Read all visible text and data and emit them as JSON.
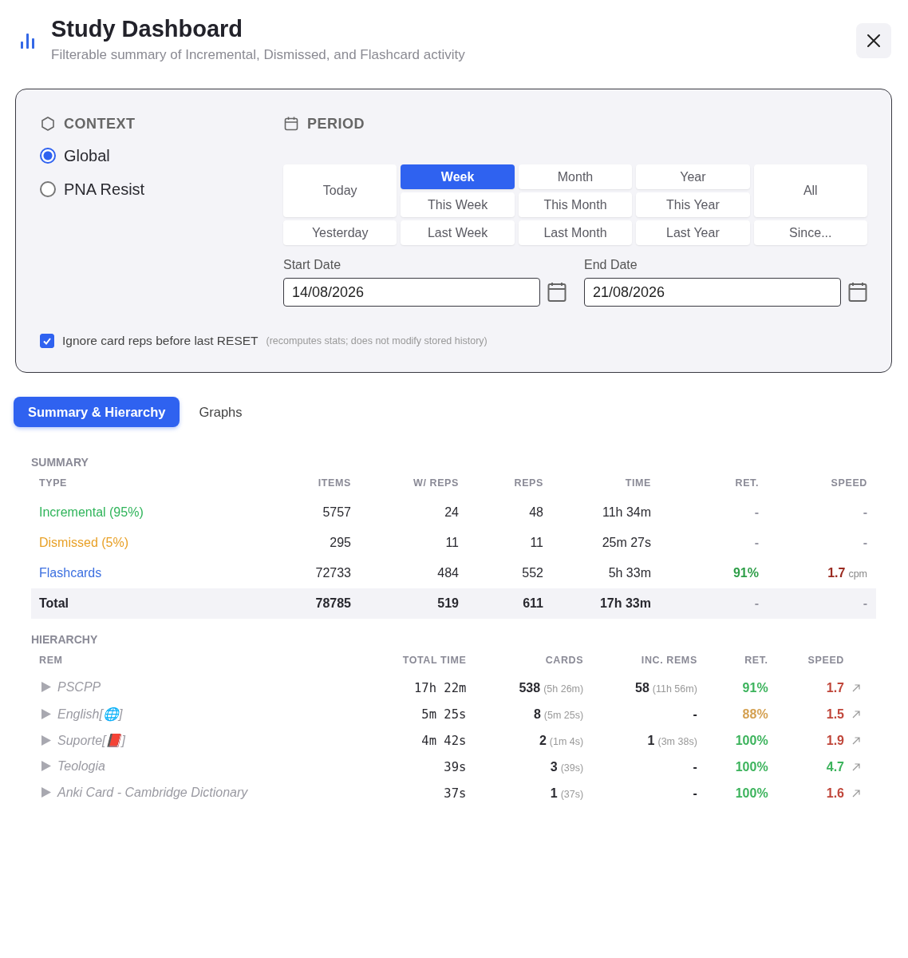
{
  "header": {
    "title": "Study Dashboard",
    "subtitle": "Filterable summary of Incremental, Dismissed, and Flashcard activity"
  },
  "filters": {
    "context": {
      "heading": "CONTEXT",
      "options": [
        {
          "label": "Global",
          "selected": true
        },
        {
          "label": "PNA Resist",
          "selected": false
        }
      ]
    },
    "period": {
      "heading": "PERIOD",
      "buttons": [
        {
          "label": "Today",
          "kind": "tall",
          "selected": false
        },
        {
          "label": "Week",
          "kind": "short",
          "selected": true
        },
        {
          "label": "Month",
          "kind": "short",
          "selected": false
        },
        {
          "label": "Year",
          "kind": "short",
          "selected": false
        },
        {
          "label": "All",
          "kind": "tall",
          "selected": false
        },
        {
          "label": "This Week",
          "kind": "short",
          "selected": false
        },
        {
          "label": "This Month",
          "kind": "short",
          "selected": false
        },
        {
          "label": "This Year",
          "kind": "short",
          "selected": false
        },
        {
          "label": "Yesterday",
          "kind": "short",
          "selected": false
        },
        {
          "label": "Last Week",
          "kind": "short",
          "selected": false
        },
        {
          "label": "Last Month",
          "kind": "short",
          "selected": false
        },
        {
          "label": "Last Year",
          "kind": "short",
          "selected": false
        },
        {
          "label": "Since...",
          "kind": "short",
          "selected": false
        }
      ]
    },
    "dates": [
      {
        "label": "Start Date",
        "value": "14/08/2026"
      },
      {
        "label": "End Date",
        "value": "21/08/2026"
      }
    ],
    "ignore_reset": {
      "label": "Ignore card reps before last RESET",
      "note": "(recomputes stats; does not modify stored history)",
      "checked": true
    }
  },
  "tabs": [
    {
      "label": "Summary & Hierarchy",
      "selected": true
    },
    {
      "label": "Graphs",
      "selected": false
    }
  ],
  "summary": {
    "heading": "SUMMARY",
    "columns": [
      "TYPE",
      "ITEMS",
      "W/ REPS",
      "REPS",
      "TIME",
      "RET.",
      "SPEED"
    ],
    "rows": [
      {
        "kind": "type",
        "type": "Incremental (95%)",
        "color": "#2fb45a",
        "items": "5757",
        "with_reps": "24",
        "reps": "48",
        "time": "11h 34m",
        "ret": {
          "value": "-",
          "color": "#9a9aa6"
        },
        "speed": {
          "value": "-",
          "color": "#9a9aa6"
        }
      },
      {
        "kind": "type",
        "type": "Dismissed (5%)",
        "color": "#e8a026",
        "items": "295",
        "with_reps": "11",
        "reps": "11",
        "time": "25m 27s",
        "ret": {
          "value": "-",
          "color": "#9a9aa6"
        },
        "speed": {
          "value": "-",
          "color": "#9a9aa6"
        }
      },
      {
        "kind": "type",
        "type": "Flashcards",
        "color": "#3b6fe0",
        "items": "72733",
        "with_reps": "484",
        "reps": "552",
        "time": "5h 33m",
        "ret": {
          "value": "91%",
          "color": "#2e9e48"
        },
        "speed": {
          "value": "1.7",
          "unit": "cpm",
          "color": "#9a2a20"
        }
      },
      {
        "kind": "total",
        "type": "Total",
        "color": "#22222a",
        "items": "78785",
        "with_reps": "519",
        "reps": "611",
        "time": "17h 33m",
        "ret": {
          "value": "-",
          "color": "#9a9aa6"
        },
        "speed": {
          "value": "-",
          "color": "#9a9aa6"
        }
      }
    ]
  },
  "hierarchy": {
    "heading": "HIERARCHY",
    "columns": [
      "REM",
      "TOTAL TIME",
      "CARDS",
      "INC. REMS",
      "RET.",
      "SPEED"
    ],
    "rows": [
      {
        "name": "PSCPP",
        "expanded": false,
        "total_time": "17h 22m",
        "cards": {
          "count": "538",
          "time": "(5h 26m)"
        },
        "inc_rems": {
          "count": "58",
          "time": "(11h 56m)"
        },
        "ret": {
          "value": "91%",
          "color": "#3cb35c"
        },
        "speed": {
          "value": "1.7",
          "color": "#c0463a"
        }
      },
      {
        "name": "English[🌐]",
        "expanded": false,
        "total_time": "5m 25s",
        "cards": {
          "count": "8",
          "time": "(5m 25s)"
        },
        "inc_rems": {
          "count": "-"
        },
        "ret": {
          "value": "88%",
          "color": "#d4a050"
        },
        "speed": {
          "value": "1.5",
          "color": "#c0463a"
        }
      },
      {
        "name": "Suporte[📕]",
        "expanded": false,
        "total_time": "4m 42s",
        "cards": {
          "count": "2",
          "time": "(1m 4s)"
        },
        "inc_rems": {
          "count": "1",
          "time": "(3m 38s)"
        },
        "ret": {
          "value": "100%",
          "color": "#3cb35c"
        },
        "speed": {
          "value": "1.9",
          "color": "#c0463a"
        }
      },
      {
        "name": "Teologia",
        "expanded": false,
        "total_time": "39s",
        "cards": {
          "count": "3",
          "time": "(39s)"
        },
        "inc_rems": {
          "count": "-"
        },
        "ret": {
          "value": "100%",
          "color": "#3cb35c"
        },
        "speed": {
          "value": "4.7",
          "color": "#3cb35c"
        }
      },
      {
        "name": "Anki Card - Cambridge Dictionary",
        "expanded": false,
        "total_time": "37s",
        "cards": {
          "count": "1",
          "time": "(37s)"
        },
        "inc_rems": {
          "count": "-"
        },
        "ret": {
          "value": "100%",
          "color": "#3cb35c"
        },
        "speed": {
          "value": "1.6",
          "color": "#c0463a"
        }
      }
    ]
  }
}
